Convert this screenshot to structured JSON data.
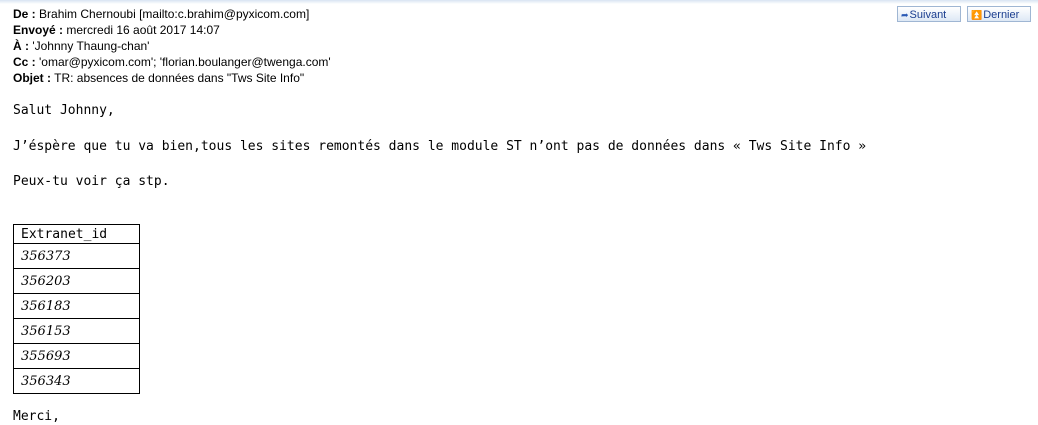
{
  "email": {
    "header": {
      "from_label": "De :",
      "from_value": "Brahim Chernoubi [mailto:c.brahim@pyxicom.com]",
      "sent_label": "Envoyé :",
      "sent_value": "mercredi 16 août 2017 14:07",
      "to_label": "À :",
      "to_value": "'Johnny Thaung-chan'",
      "cc_label": "Cc :",
      "cc_value": "'omar@pyxicom.com'; 'florian.boulanger@twenga.com'",
      "subject_label": "Objet :",
      "subject_value": "TR: absences de données dans \"Tws Site Info\""
    },
    "nav": {
      "next_label": "Suivant",
      "next_icon": "arrow-right-icon",
      "last_label": "Dernier",
      "last_icon": "double-arrow-up-icon"
    },
    "body": {
      "greeting": "Salut Johnny,",
      "message": "J’éspère que tu va bien,tous les sites remontés dans le module ST n’ont pas de données dans « Tws Site Info »",
      "ask": "Peux-tu voir ça stp.",
      "table": {
        "header": "Extranet_id",
        "rows": [
          "356373",
          "356203",
          "356183",
          "356153",
          "355693",
          "356343"
        ]
      },
      "thanks": "Merci,"
    }
  }
}
